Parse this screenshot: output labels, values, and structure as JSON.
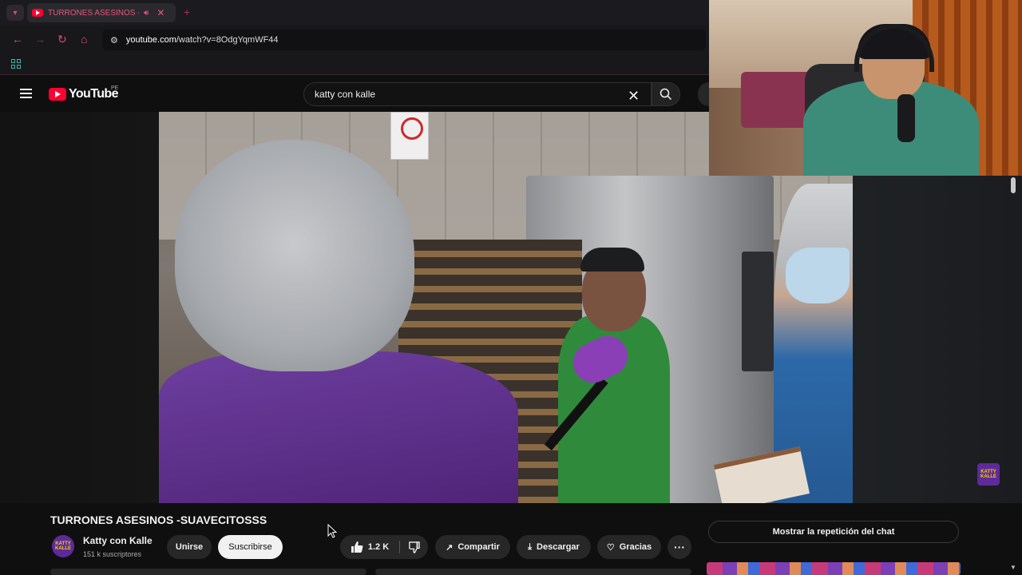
{
  "browser": {
    "tab_title": "TURRONES ASESINOS -SUAVECITOSSS",
    "url_host": "youtube.com",
    "url_path": "/watch?v=8OdgYqmWF44"
  },
  "youtube": {
    "logo_text": "YouTube",
    "country_code": "PE",
    "search_query": "katty con kalle"
  },
  "video": {
    "title": "TURRONES ASESINOS -SUAVECITOSSS",
    "watermark": "KATTY KALLE",
    "mic_logo": "KATTY KALLE"
  },
  "channel": {
    "name": "Katty con Kalle",
    "subscribers": "151 k suscriptores",
    "avatar_text": "KATTY KALLE"
  },
  "actions": {
    "join_label": "Unirse",
    "subscribe_label": "Suscribirse",
    "like_count": "1.2 K",
    "share_label": "Compartir",
    "download_label": "Descargar",
    "thanks_label": "Gracias"
  },
  "chat": {
    "replay_label": "Mostrar la repetición del chat"
  },
  "colors": {
    "brand_red": "#ff0033",
    "accent_pink": "#e04c6e",
    "channel_purple": "#5e2a9a"
  }
}
